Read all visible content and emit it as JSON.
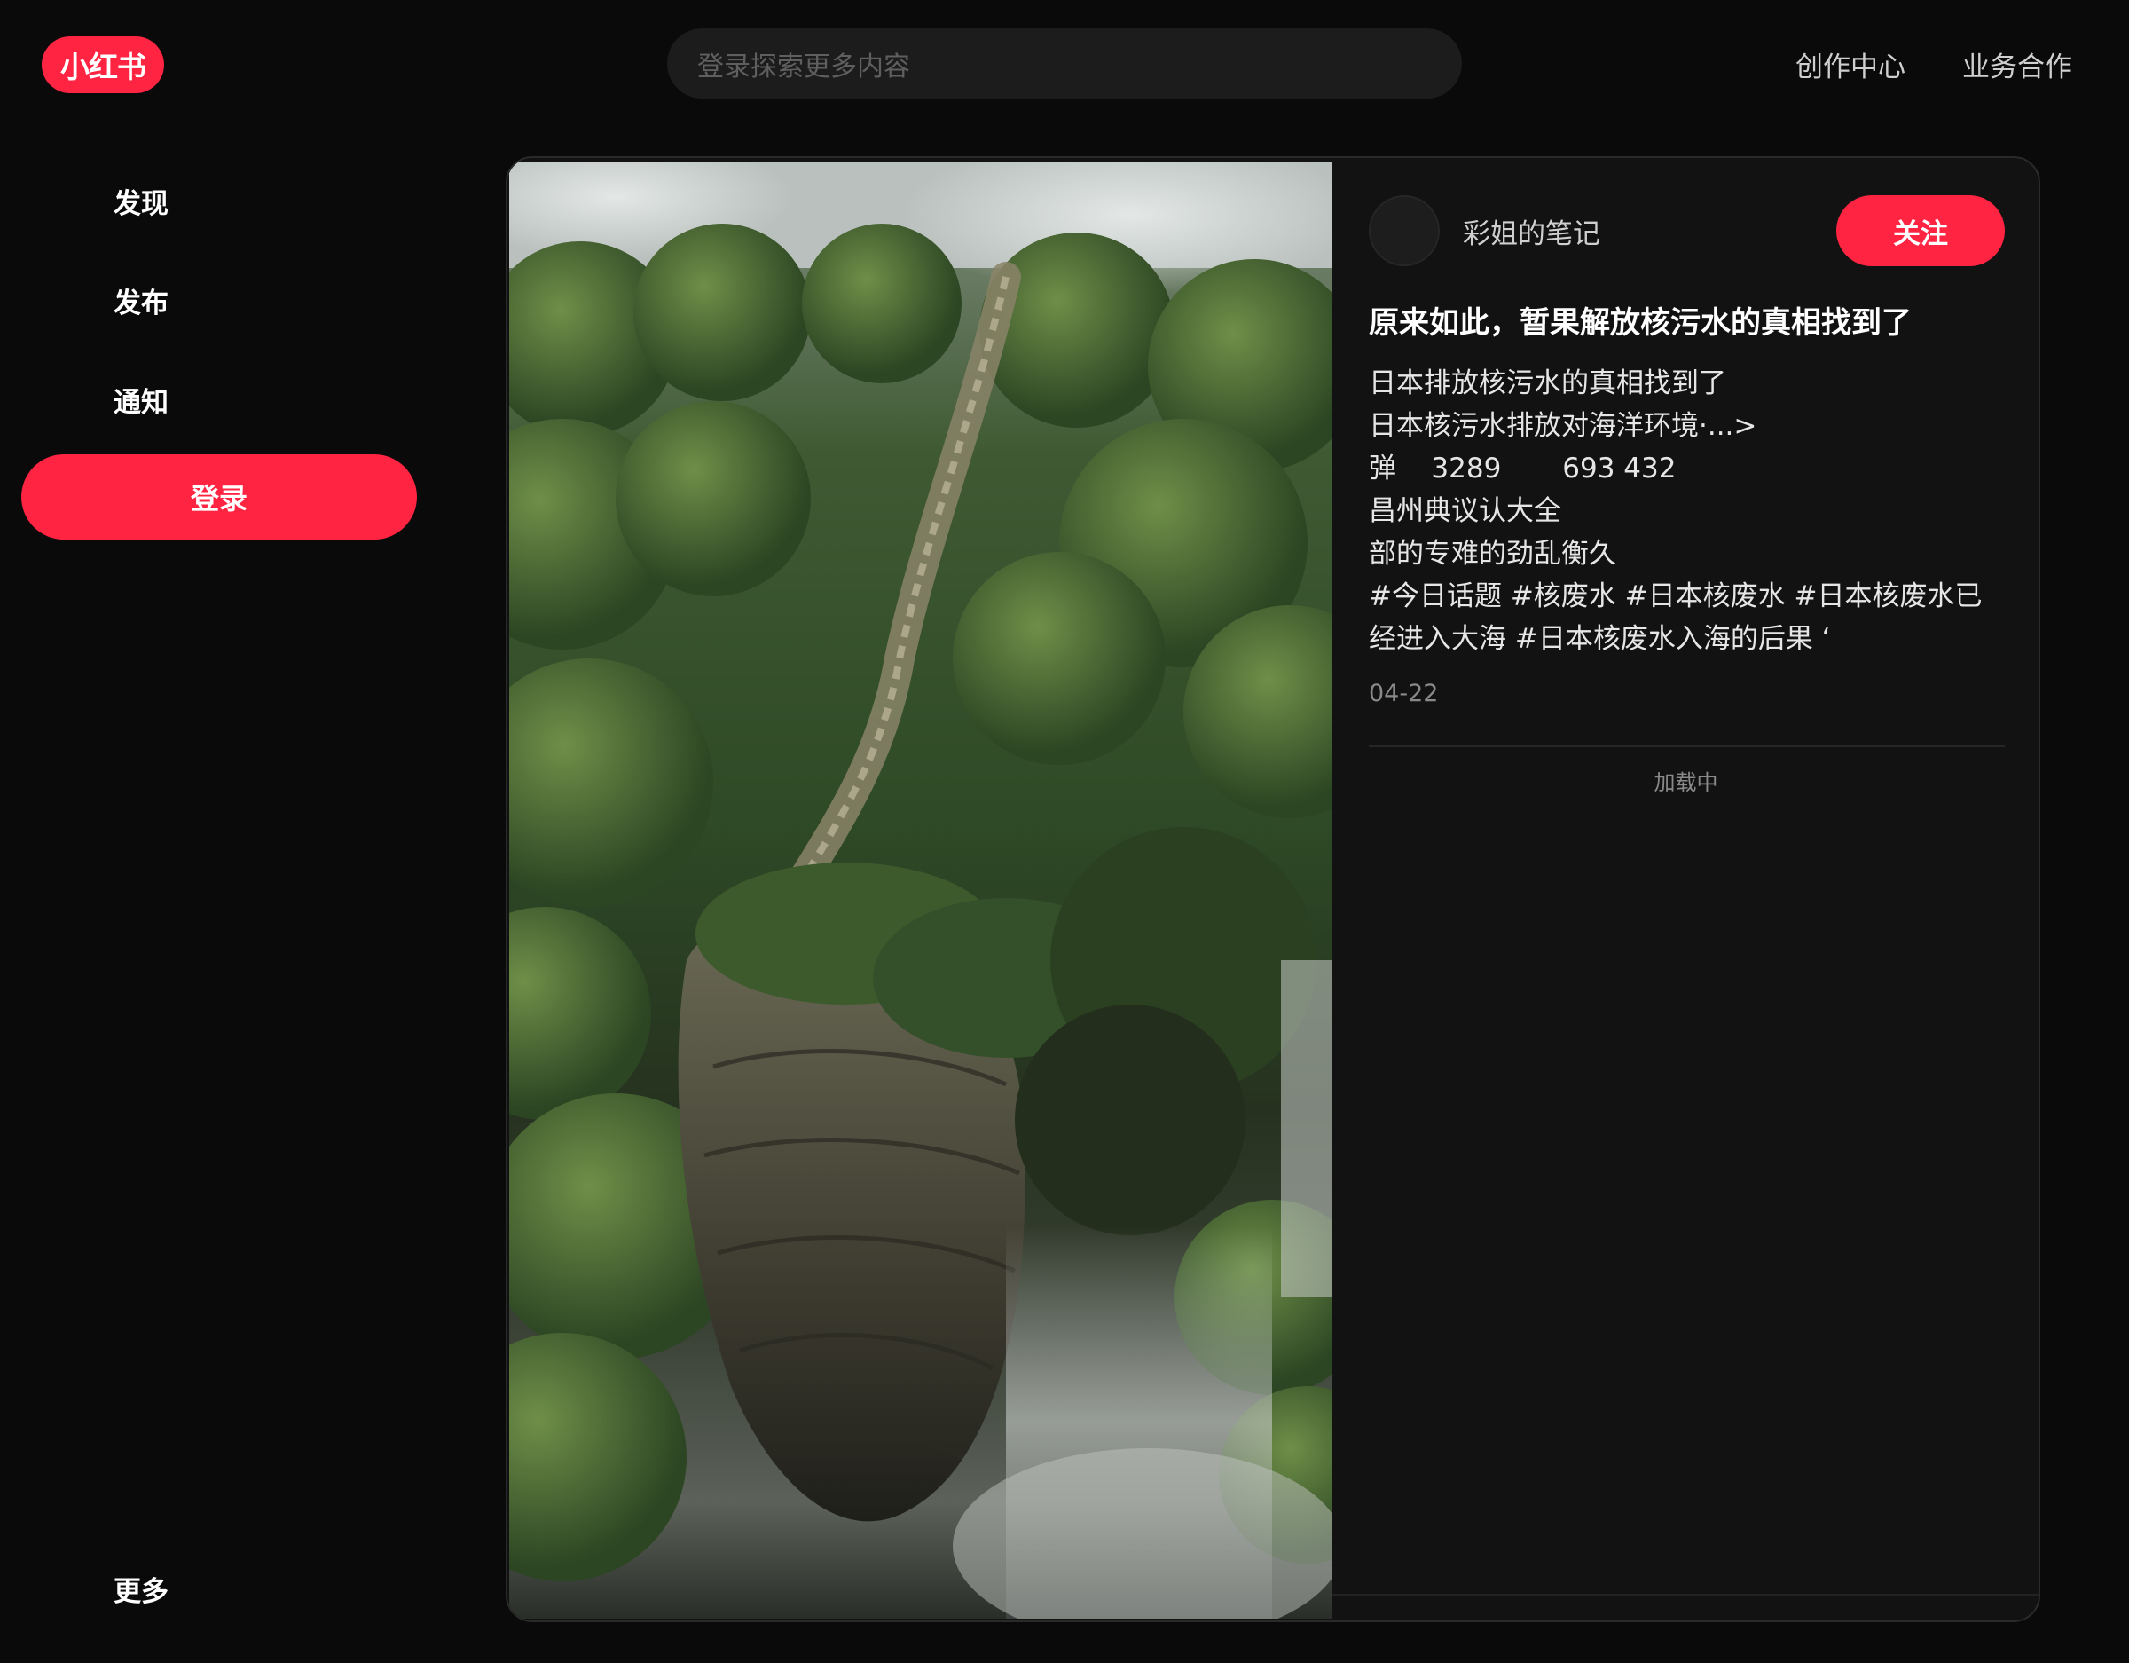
{
  "header": {
    "logo_text": "小红书",
    "search_placeholder": "登录探索更多内容",
    "links": [
      "创作中心",
      "业务合作"
    ]
  },
  "sidebar": {
    "items": [
      {
        "label": "发现"
      },
      {
        "label": "发布"
      },
      {
        "label": "通知"
      }
    ],
    "login_label": "登录",
    "more_label": "更多"
  },
  "note": {
    "author": "彩姐的笔记",
    "follow_label": "关注",
    "title": "原来如此，暂果解放核污水的真相找到了",
    "desc_lines": [
      "日本排放核污水的真相找到了",
      "日本核污水排放对海洋环境·...>",
      "弹    3289       693 432",
      "昌州典议认大全",
      "部的专难的劲乱衡久"
    ],
    "tags_line1": "#今日话题 #核废水 #日本核废水 #日本核废水已",
    "tags_line2": "经进入大海 #日本核废水入海的后果 ‘",
    "date": "04-22",
    "loading_label": "加载中"
  },
  "colors": {
    "accent": "#ff2442",
    "background": "#0a0a0a",
    "panel": "#121212"
  }
}
